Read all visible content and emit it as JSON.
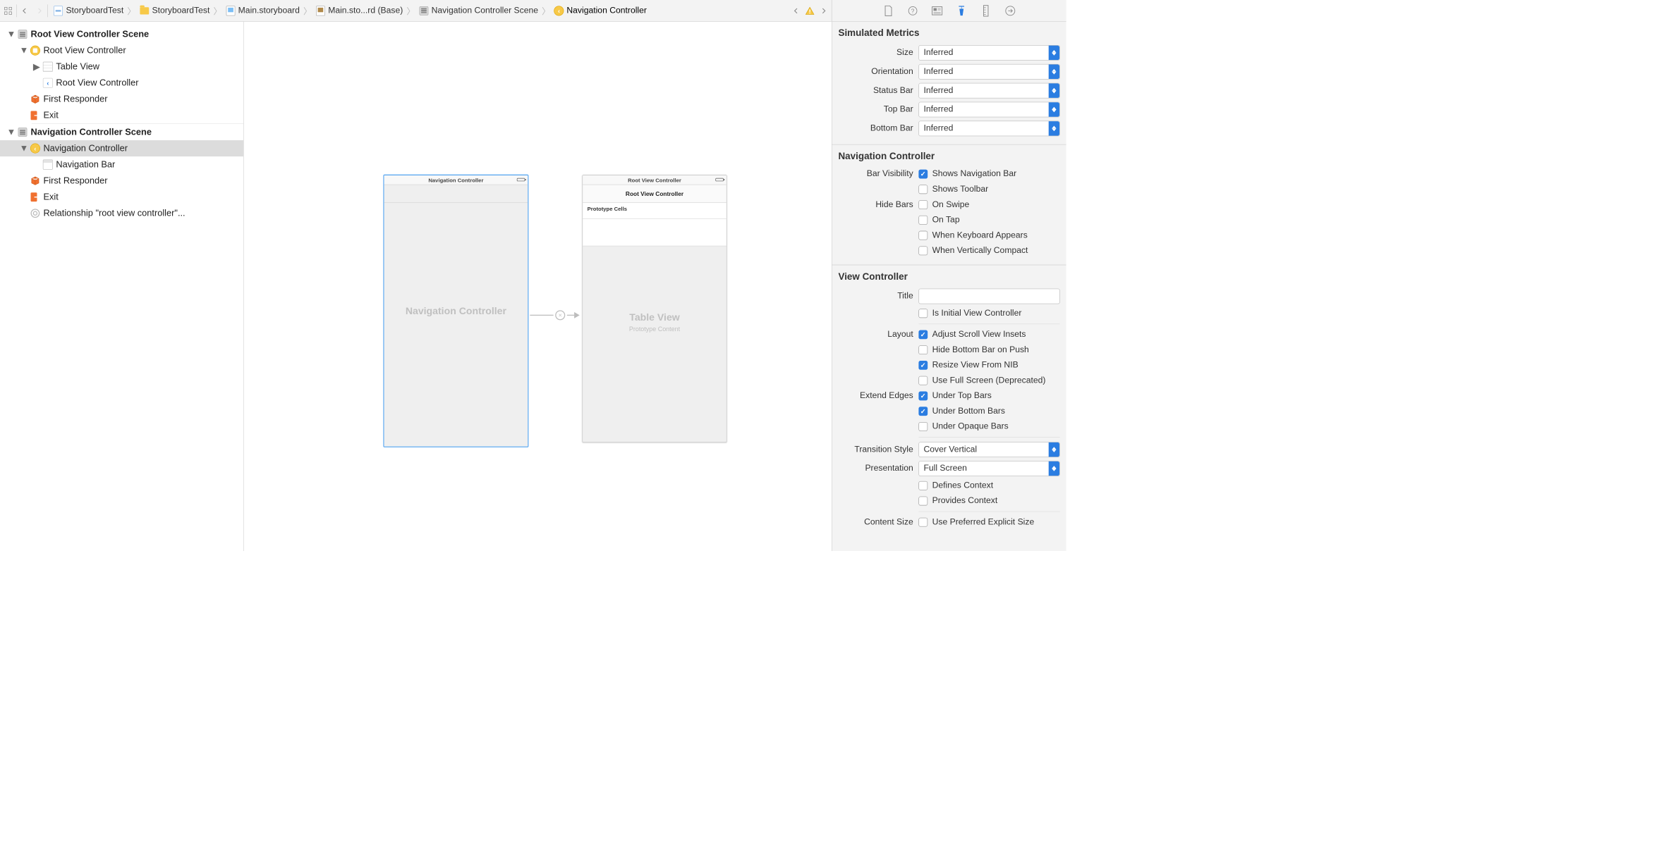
{
  "breadcrumbs": {
    "items": [
      "StoryboardTest",
      "StoryboardTest",
      "Main.storyboard",
      "Main.sto...rd (Base)",
      "Navigation Controller Scene",
      "Navigation Controller"
    ]
  },
  "outline": {
    "scene1": {
      "title": "Root View Controller Scene",
      "root_vc": "Root View Controller",
      "table_view": "Table View",
      "nav_item": "Root View Controller",
      "first_responder": "First Responder",
      "exit": "Exit"
    },
    "scene2": {
      "title": "Navigation Controller Scene",
      "nav_ctrl": "Navigation Controller",
      "nav_bar": "Navigation Bar",
      "first_responder": "First Responder",
      "exit": "Exit",
      "relationship": "Relationship \"root view controller\"..."
    }
  },
  "canvas": {
    "nav_title": "Navigation Controller",
    "nav_big": "Navigation Controller",
    "root_title": "Root View Controller",
    "root_navbar": "Root View Controller",
    "proto_cells": "Prototype Cells",
    "table_big": "Table View",
    "table_sub": "Prototype Content"
  },
  "inspector": {
    "simulated_metrics": {
      "title": "Simulated Metrics",
      "size_label": "Size",
      "size_value": "Inferred",
      "orientation_label": "Orientation",
      "orientation_value": "Inferred",
      "status_bar_label": "Status Bar",
      "status_bar_value": "Inferred",
      "top_bar_label": "Top Bar",
      "top_bar_value": "Inferred",
      "bottom_bar_label": "Bottom Bar",
      "bottom_bar_value": "Inferred"
    },
    "nav_controller": {
      "title": "Navigation Controller",
      "bar_visibility_label": "Bar Visibility",
      "shows_nav_bar": "Shows Navigation Bar",
      "shows_toolbar": "Shows Toolbar",
      "hide_bars_label": "Hide Bars",
      "on_swipe": "On Swipe",
      "on_tap": "On Tap",
      "when_kb": "When Keyboard Appears",
      "when_compact": "When Vertically Compact"
    },
    "view_controller": {
      "title": "View Controller",
      "title_label": "Title",
      "is_initial": "Is Initial View Controller",
      "layout_label": "Layout",
      "adjust_scroll": "Adjust Scroll View Insets",
      "hide_bottom": "Hide Bottom Bar on Push",
      "resize_nib": "Resize View From NIB",
      "use_full": "Use Full Screen (Deprecated)",
      "extend_label": "Extend Edges",
      "under_top": "Under Top Bars",
      "under_bottom": "Under Bottom Bars",
      "under_opaque": "Under Opaque Bars",
      "transition_label": "Transition Style",
      "transition_value": "Cover Vertical",
      "presentation_label": "Presentation",
      "presentation_value": "Full Screen",
      "defines_context": "Defines Context",
      "provides_context": "Provides Context",
      "content_size_label": "Content Size",
      "use_preferred": "Use Preferred Explicit Size"
    }
  }
}
